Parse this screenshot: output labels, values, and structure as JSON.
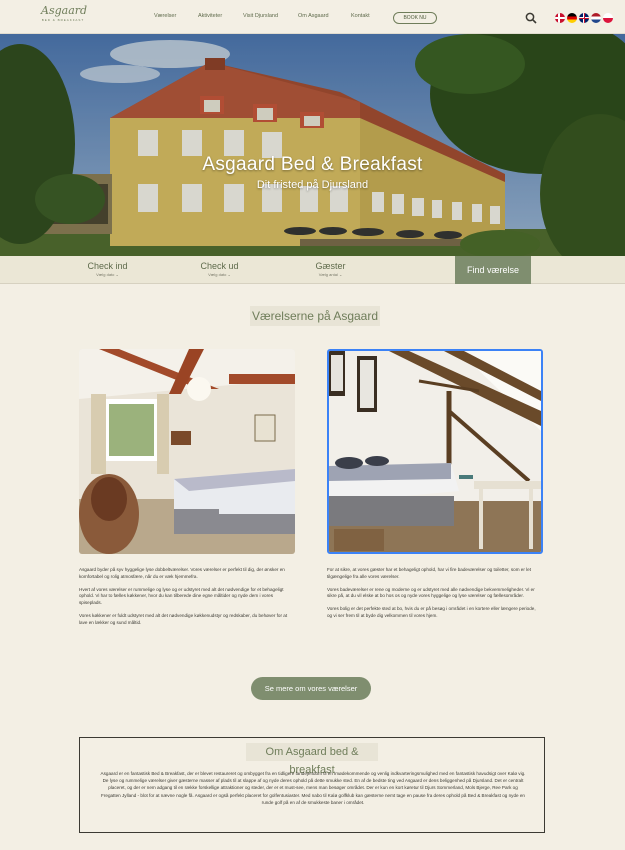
{
  "header": {
    "logo_script": "Asgaard",
    "logo_sub": "BED & BREAKFAST",
    "nav": [
      "Værelser",
      "Aktiviteter",
      "Visit Djursland",
      "Om Asgaard",
      "Kontakt"
    ],
    "book_label": "BOOK NU",
    "flags": [
      "Dansk",
      "Deutsch",
      "English",
      "Nederlands",
      "Polski"
    ]
  },
  "hero": {
    "title": "Asgaard Bed & Breakfast",
    "subtitle": "Dit fristed på Djursland"
  },
  "booking": {
    "checkin_label": "Check ind",
    "checkin_sub": "Vælg dato",
    "checkout_label": "Check ud",
    "checkout_sub": "Vælg dato",
    "guests_label": "Gæster",
    "guests_sub": "Vælg antal",
    "find_label": "Find værelse"
  },
  "rooms": {
    "title": "Værelserne på Asgaard",
    "left_paragraphs": [
      "Asgaard byder på syv hyggelige lyse dobbeltværelser. Vores værelser er perfekt til dig, der ønsker en komfortabel og rolig atmosfære, når du er væk hjemmefra.",
      "Hvert af vores værelser er rummelige og lyse og er udstyret med alt det nødvendige for et behageligt ophold. Vi har to fælles køkkener, hvor du kan tilberede dine egne måltider og nyde dem i vores spiseplads.",
      "Vores køkkener er fuldt udstyret med alt det nødvendige køkkenudstyr og redskaber, du behøver for at lave en lækker og sund måltid."
    ],
    "right_paragraphs": [
      "For at sikre, at vores gæster har et behageligt ophold, har vi fire badeværelser og toiletter, som er let tilgængelige fra alle vores værelser.",
      "Vores badeværelser er rene og moderne og er udstyret med alle nødvendige bekvemmeligheder. Vi er sikre på, at du vil elske at bo hos os og nyde vores hyggelige og lyse værelser og fællesområder.",
      "Vores bolig er det perfekte sted at bo, hvis du er på besøg i området i en kortere eller længere periode, og vi ser frem til at byde dig velkommen til vores hjem."
    ],
    "more_label": "Se mere om vores værelser"
  },
  "about": {
    "title": "Om Asgaard bed & breakfast",
    "text": "Asgaard er en fantastisk Bed & Breakfast, der er blevet restaureret og ombygget fra en tidligere landejendom til en imødekommende og venlig indkvarteringsmulighed med en fantastisk havudsigt over Kalø vig. De lyse og rummelige værelser giver gæsterne masser af plads til at slappe af og nyde deres ophold på dette smukke sted. En af de bedste ting ved Asgaard er dens beliggenhed på Djursland. Det er centralt placeret, og der er nem adgang til en række forskellige attraktioner og steder, der er et must-see, mens man besøger området. Der er kun en kort køretur til Djurs Sommerland, Mols Bjerge, Ree Park og Fregatten Jylland - blot for at nævne nogle få. Asgaard er også perfekt placeret for golfentusiaster. Med nabo til Kalø golfklub kan gæsterne nemt tage en pause fra deres ophold på Bed & Breakfast og nyde en runde golf på en af de smukkeste baner i området."
  },
  "colors": {
    "background": "#f3efe4",
    "accent_green": "#7f8e6f",
    "text_dark": "#3b3a33",
    "selected_border": "#3b82f6"
  }
}
